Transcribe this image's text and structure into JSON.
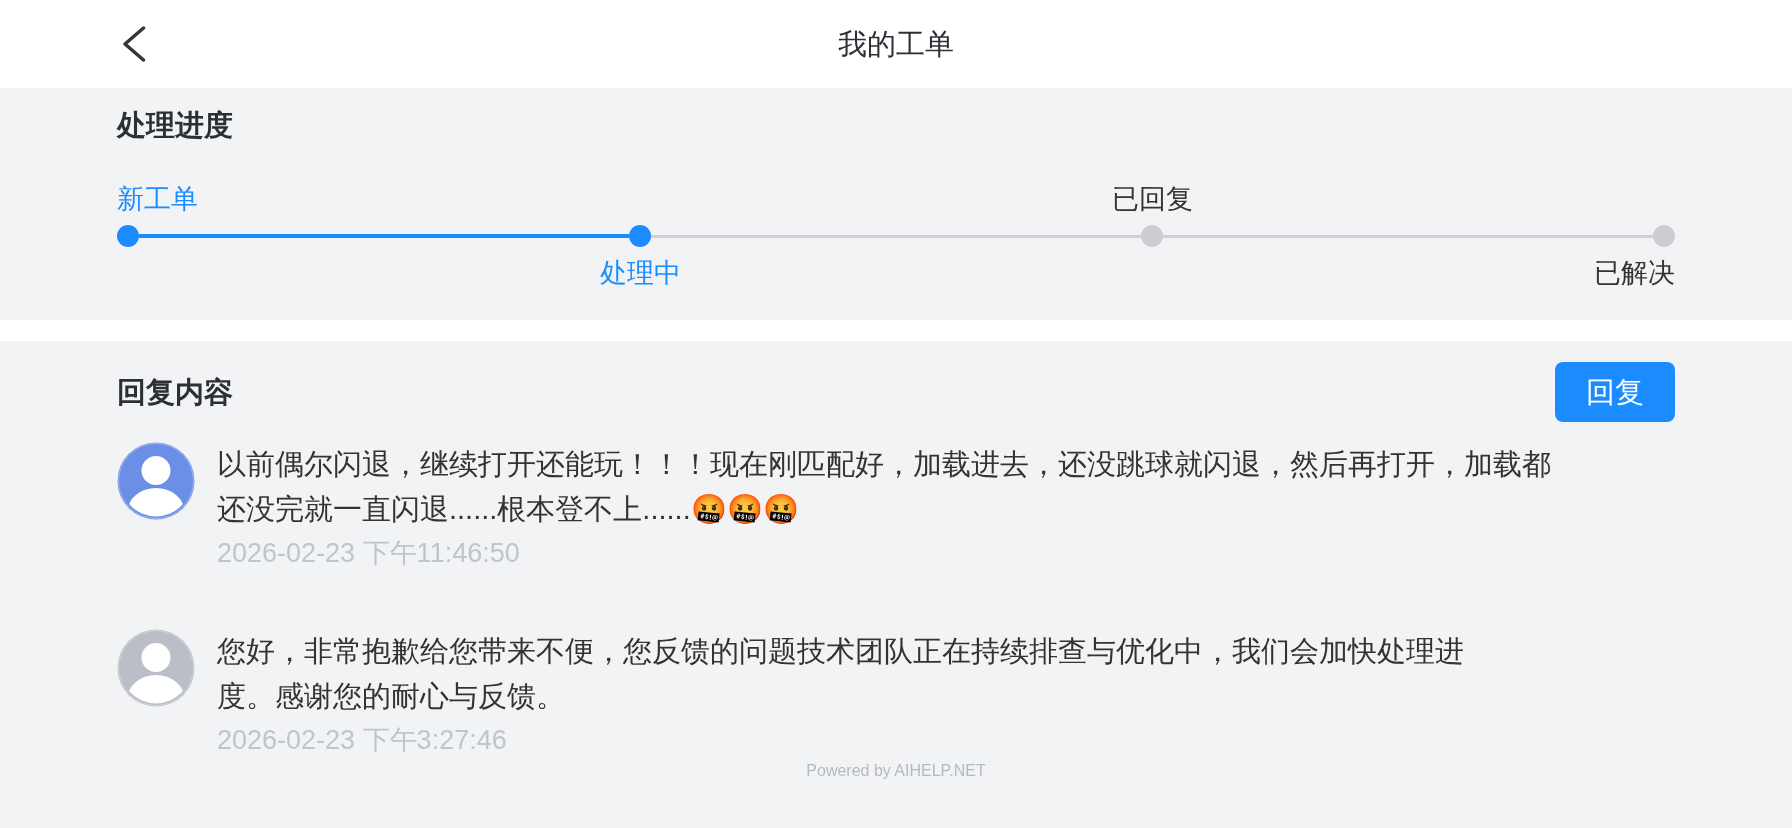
{
  "header": {
    "title": "我的工单"
  },
  "progress": {
    "title": "处理进度",
    "steps": [
      {
        "label": "新工单",
        "reached": true
      },
      {
        "label": "处理中",
        "reached": true
      },
      {
        "label": "已回复",
        "reached": false
      },
      {
        "label": "已解决",
        "reached": false
      }
    ]
  },
  "replies": {
    "title": "回复内容",
    "reply_button": "回复",
    "messages": [
      {
        "kind": "user",
        "text": "以前偶尔闪退，继续打开还能玩！！！现在刚匹配好，加载进去，还没跳球就闪退，然后再打开，加载都还没完就一直闪退......根本登不上......🤬🤬🤬",
        "time": "2026-02-23 下午11:46:50"
      },
      {
        "kind": "agent",
        "text": "您好，非常抱歉给您带来不便，您反馈的问题技术团队正在持续排查与优化中，我们会加快处理进度。感谢您的耐心与反馈。",
        "time": "2026-02-23 下午3:27:46"
      }
    ]
  },
  "footer": "Powered by AIHELP.NET"
}
